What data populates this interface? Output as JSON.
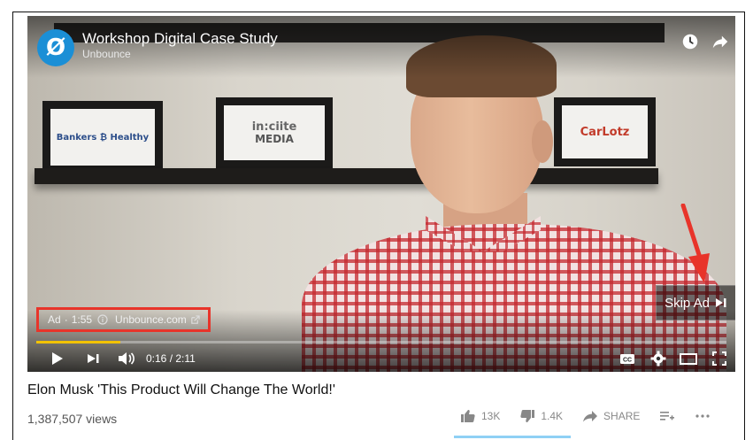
{
  "video": {
    "title": "Workshop Digital Case Study",
    "channel": "Unbounce",
    "channel_logo_glyph": "Ø",
    "frames": [
      {
        "name": "Bankers",
        "text": "Bankers ₿ Healthy"
      },
      {
        "name": "incite-media",
        "text_line1": "in:ciite",
        "text_line2": "MEDIA"
      },
      {
        "name": "carlotz",
        "text": "CarLotz"
      }
    ],
    "ad": {
      "label": "Ad",
      "separator": "·",
      "remaining": "1:55",
      "url": "Unbounce.com"
    },
    "skip_label": "Skip Ad",
    "time": "0:16 / 2:11",
    "progress_percent": 12.2,
    "colors": {
      "ad_box_border": "#e8342a",
      "arrow": "#e8342a",
      "progress": "#f2c200",
      "logo": "#1b8fd6"
    },
    "icons": [
      "clock-icon",
      "share-arrow-icon",
      "play-icon",
      "next-icon",
      "volume-icon",
      "cc-icon",
      "gear-icon",
      "theater-icon",
      "fullscreen-icon"
    ]
  },
  "page": {
    "title": "Elon Musk 'This Product Will Change The World!'",
    "views": "1,387,507 views",
    "likes": "13K",
    "dislikes": "1.4K",
    "share_label": "SHARE"
  }
}
